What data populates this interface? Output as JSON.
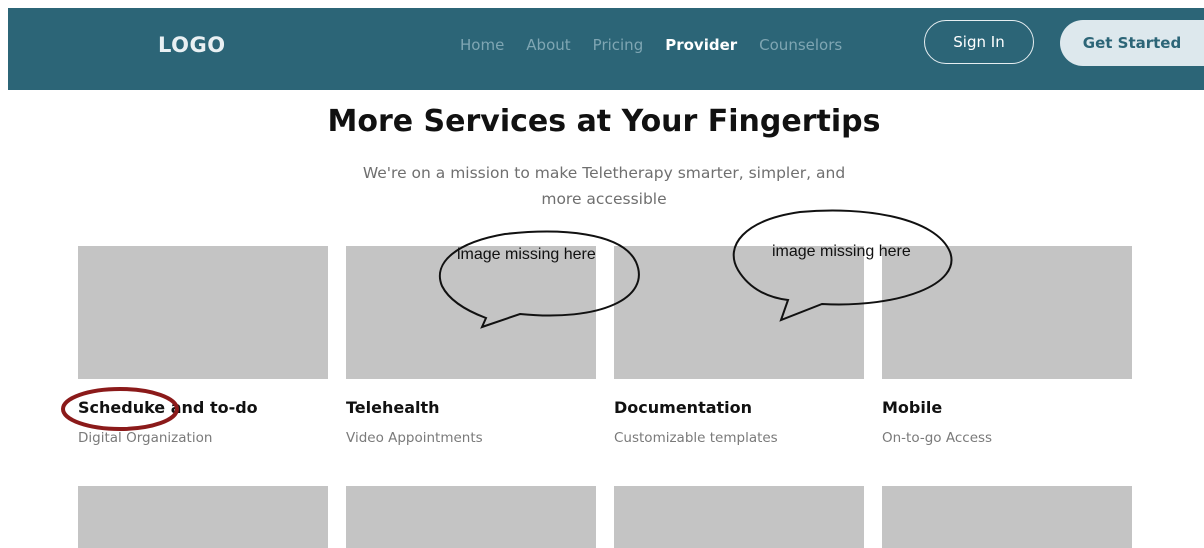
{
  "navbar": {
    "logo": "LOGO",
    "links": [
      {
        "label": "Home"
      },
      {
        "label": "About"
      },
      {
        "label": "Pricing"
      },
      {
        "label": "Provider",
        "active": true
      },
      {
        "label": "Counselors"
      }
    ],
    "sign_in": "Sign In",
    "get_started": "Get Started"
  },
  "hero": {
    "title": "More Services at Your Fingertips",
    "subtitle_line1": "We're on a mission to make Teletherapy smarter, simpler, and",
    "subtitle_line2": "more accessible"
  },
  "services": [
    {
      "title": "Scheduke and to-do",
      "subtitle": "Digital Organization"
    },
    {
      "title": "Telehealth",
      "subtitle": "Video Appointments"
    },
    {
      "title": "Documentation",
      "subtitle": "Customizable templates"
    },
    {
      "title": "Mobile",
      "subtitle": "On-to-go Access"
    }
  ],
  "annotations": {
    "bubble_1": "image missing here",
    "bubble_2": "image missing here"
  },
  "colors": {
    "navbar_bg": "#2c6577",
    "placeholder_gray": "#c4c4c4",
    "annotation_circle": "#8b1a1a"
  }
}
